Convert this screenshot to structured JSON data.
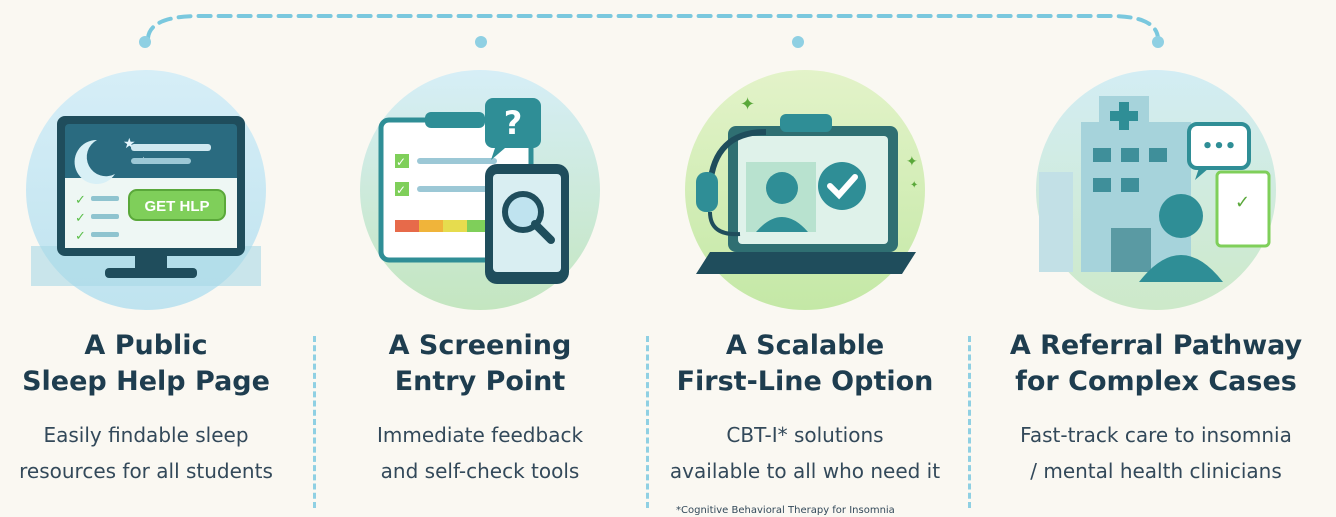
{
  "cards": [
    {
      "title_line1": "A Public",
      "title_line2": "Sleep Help Page",
      "desc_line1": "Easily findable sleep",
      "desc_line2": "resources for all students",
      "illustration": "monitor-help-icon",
      "button_text": "GET HLP"
    },
    {
      "title_line1": "A Screening",
      "title_line2": "Entry Point",
      "desc_line1": "Immediate feedback",
      "desc_line2": "and self-check tools",
      "illustration": "checklist-tablet-icon",
      "bubble_text": "?"
    },
    {
      "title_line1": "A Scalable",
      "title_line2": "First-Line Option",
      "desc_line1": "CBT-I* solutions",
      "desc_line2": "available to all who need it",
      "illustration": "telehealth-laptop-icon"
    },
    {
      "title_line1": "A Referral Pathway",
      "title_line2": "for Complex Cases",
      "desc_line1": "Fast-track care to insomnia",
      "desc_line2": "/ mental health clinicians",
      "illustration": "hospital-clinician-icon",
      "bubble_text": "•••"
    }
  ],
  "footnote": "*Cognitive Behavioral Therapy for Insomnia",
  "colors": {
    "teal": "#2f8e96",
    "light_teal": "#8fd0e3",
    "green": "#7fcf5a",
    "navy": "#1e3d4f",
    "circle_blue": "#cfeaf4",
    "circle_green": "#d8efc0"
  }
}
